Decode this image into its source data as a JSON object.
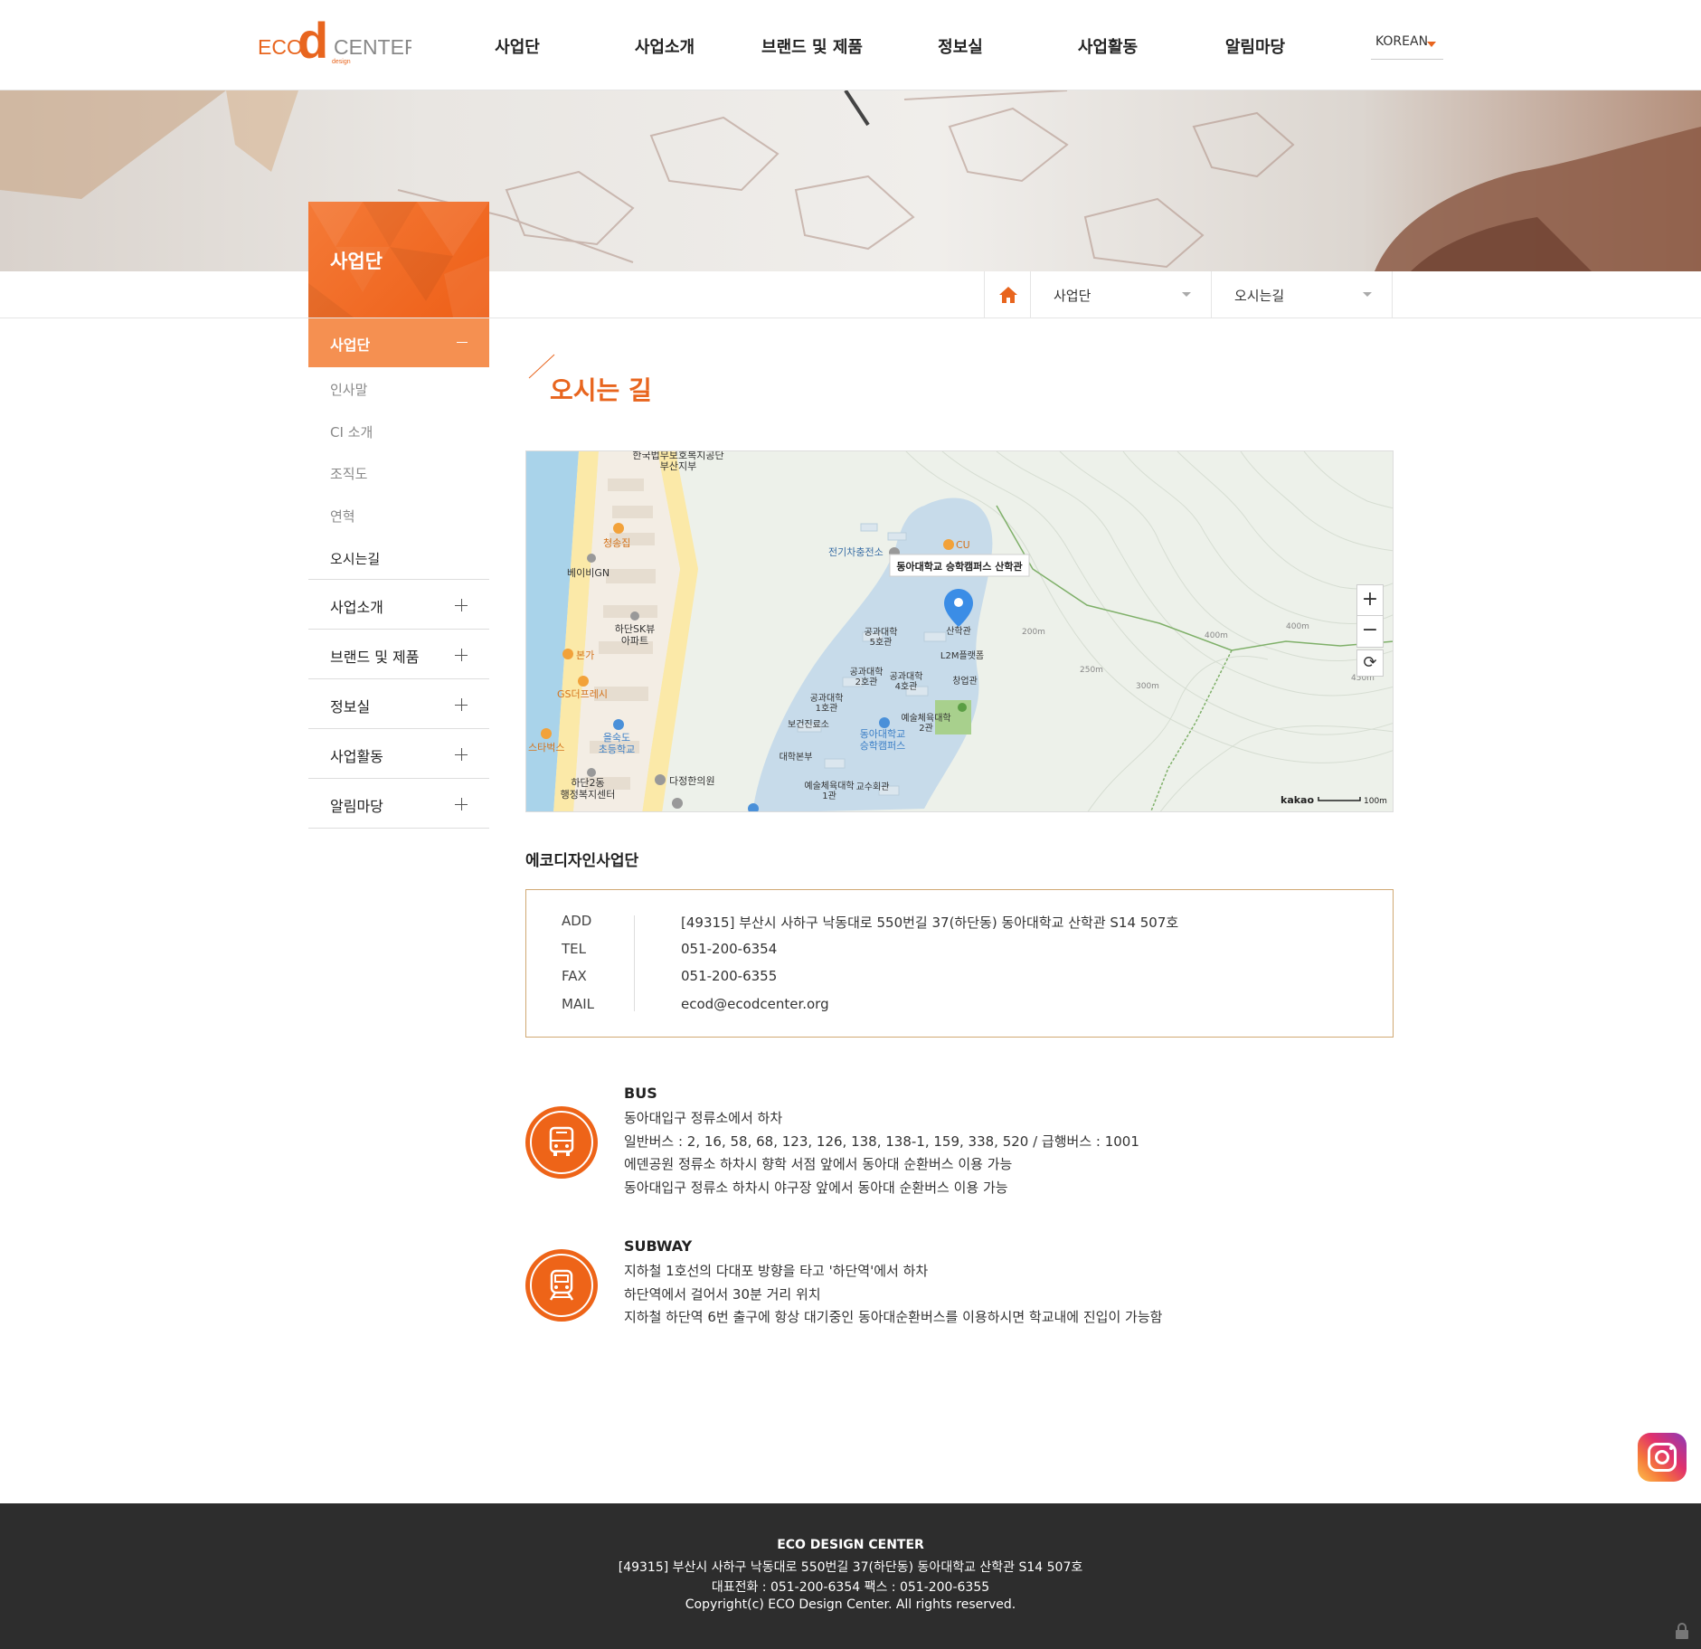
{
  "header": {
    "logo": {
      "text_left": "ECO",
      "text_mid": "d",
      "text_small": "design",
      "text_right": "CENTER"
    },
    "nav": [
      "사업단",
      "사업소개",
      "브랜드 및 제품",
      "정보실",
      "사업활동",
      "알림마당"
    ],
    "language": "KOREAN"
  },
  "sidebar": {
    "title": "사업단",
    "active_menu": "사업단",
    "sub_items": [
      "인사말",
      "CI 소개",
      "조직도",
      "연혁",
      "오시는길"
    ],
    "menus": [
      "사업소개",
      "브랜드 및 제품",
      "정보실",
      "사업활동",
      "알림마당"
    ]
  },
  "breadcrumb": {
    "level1": "사업단",
    "level2": "오시는길"
  },
  "content": {
    "page_title": "오시는 길",
    "map": {
      "marker_label": "동아대학교 승학캠퍼스 산학관",
      "labels": [
        "한국법무보호복지공단",
        "부산지부",
        "청송집",
        "베이비GN",
        "하단SK뷰",
        "아파트",
        "본가",
        "GS더프레시",
        "스타벅스",
        "을숙도",
        "초등학교",
        "하단2동",
        "행정복지센터",
        "다정한의원",
        "전기차충전소",
        "CU",
        "산학관",
        "L2M플랫폼",
        "공과대학",
        "5호관",
        "2호관",
        "4호관",
        "창업관",
        "1호관",
        "보건진료소",
        "예술체육대학",
        "2관",
        "동아대학교",
        "승학캠퍼스",
        "대학본부",
        "교수회관",
        "1관",
        "200m",
        "250m",
        "300m",
        "400m",
        "450m"
      ],
      "zoom_in": "+",
      "zoom_out": "−",
      "reset": "⟳",
      "brand": "kakao",
      "scale": "100m"
    },
    "org_name": "에코디자인사업단",
    "info": [
      {
        "key": "ADD",
        "value": "[49315] 부산시 사하구 낙동대로 550번길 37(하단동) 동아대학교 산학관 S14 507호"
      },
      {
        "key": "TEL",
        "value": "051-200-6354"
      },
      {
        "key": "FAX",
        "value": "051-200-6355"
      },
      {
        "key": "MAIL",
        "value": "ecod@ecodcenter.org"
      }
    ],
    "transport": [
      {
        "icon": "bus-icon",
        "title": "BUS",
        "lines": [
          "동아대입구 정류소에서 하차",
          "일반버스 : 2, 16, 58, 68, 123, 126, 138, 138-1, 159, 338, 520 / 급행버스 : 1001",
          "에덴공원 정류소 하차시 향학 서점 앞에서 동아대 순환버스 이용 가능",
          "동아대입구 정류소 하차시 야구장 앞에서 동아대 순환버스 이용 가능"
        ]
      },
      {
        "icon": "train-icon",
        "title": "SUBWAY",
        "lines": [
          "지하철 1호선의 다대포 방향을 타고 '하단역'에서 하차",
          "하단역에서 걸어서 30분 거리 위치",
          "지하철 하단역 6번 출구에 항상 대기중인 동아대순환버스를 이용하시면 학교내에 진입이 가능함"
        ]
      }
    ]
  },
  "footer": {
    "name": "ECO DESIGN CENTER",
    "address": "[49315] 부산시 사하구 낙동대로 550번길 37(하단동) 동아대학교 산학관 S14 507호",
    "phone": "대표전화 : 051-200-6354 팩스 : 051-200-6355",
    "copyright": "Copyright(c) ECO Design Center. All rights reserved."
  },
  "colors": {
    "accent": "#ee6418",
    "accent_light": "#f59051",
    "footer_bg": "#2d2d2d",
    "info_border": "#d0a873"
  }
}
